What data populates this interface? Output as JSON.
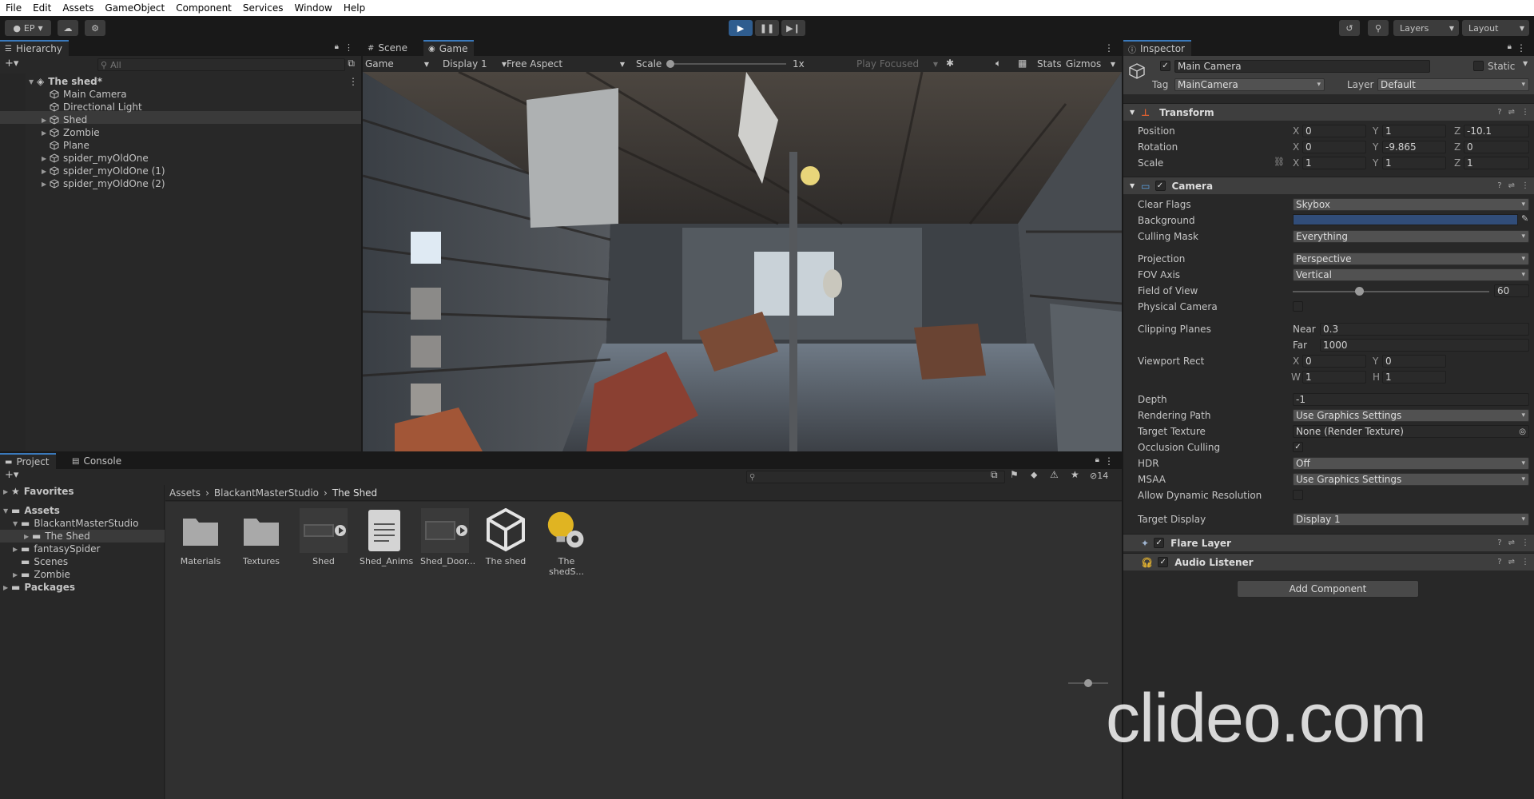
{
  "menu": [
    "File",
    "Edit",
    "Assets",
    "GameObject",
    "Component",
    "Services",
    "Window",
    "Help"
  ],
  "toolbar": {
    "account": "EP",
    "layers": "Layers",
    "layout": "Layout"
  },
  "hierarchy": {
    "tab": "Hierarchy",
    "search_placeholder": "All",
    "scene": "The shed*",
    "items": [
      "Main Camera",
      "Directional Light",
      "Shed",
      "Zombie",
      "Plane",
      "spider_myOldOne",
      "spider_myOldOne (1)",
      "spider_myOldOne (2)"
    ]
  },
  "game": {
    "tabs": [
      "Scene",
      "Game"
    ],
    "mode": "Game",
    "display": "Display 1",
    "aspect": "Free Aspect",
    "scale_label": "Scale",
    "scale_value": "1x",
    "play_focused": "Play Focused",
    "stats": "Stats",
    "gizmos": "Gizmos"
  },
  "project": {
    "tabs": [
      "Project",
      "Console"
    ],
    "hidden_count": "14",
    "breadcrumb": [
      "Assets",
      "BlackantMasterStudio",
      "The Shed"
    ],
    "tree": {
      "favorites": "Favorites",
      "assets": "Assets",
      "items": [
        "BlackantMasterStudio",
        "The Shed",
        "fantasySpider",
        "Scenes",
        "Zombie"
      ],
      "packages": "Packages"
    },
    "assets": [
      "Materials",
      "Textures",
      "Shed",
      "Shed_Anims",
      "Shed_Door...",
      "The shed",
      "The shedS..."
    ]
  },
  "inspector": {
    "tab": "Inspector",
    "object_name": "Main Camera",
    "static": "Static",
    "tag_label": "Tag",
    "tag": "MainCamera",
    "layer_label": "Layer",
    "layer": "Default",
    "transform": {
      "title": "Transform",
      "position_label": "Position",
      "rotation_label": "Rotation",
      "scale_label": "Scale",
      "position": [
        "0",
        "1",
        "-10.1"
      ],
      "rotation": [
        "0",
        "-9.865",
        "0"
      ],
      "scale": [
        "1",
        "1",
        "1"
      ]
    },
    "camera": {
      "title": "Camera",
      "clear_flags_label": "Clear Flags",
      "clear_flags": "Skybox",
      "background_label": "Background",
      "culling_mask_label": "Culling Mask",
      "culling_mask": "Everything",
      "projection_label": "Projection",
      "projection": "Perspective",
      "fov_axis_label": "FOV Axis",
      "fov_axis": "Vertical",
      "fov_label": "Field of View",
      "fov": "60",
      "physical_label": "Physical Camera",
      "clipping_label": "Clipping Planes",
      "near_label": "Near",
      "near": "0.3",
      "far_label": "Far",
      "far": "1000",
      "viewport_label": "Viewport Rect",
      "viewport": {
        "x": "0",
        "y": "0",
        "w": "1",
        "h": "1"
      },
      "depth_label": "Depth",
      "depth": "-1",
      "rendering_path_label": "Rendering Path",
      "rendering_path": "Use Graphics Settings",
      "target_texture_label": "Target Texture",
      "target_texture": "None (Render Texture)",
      "occlusion_label": "Occlusion Culling",
      "hdr_label": "HDR",
      "hdr": "Off",
      "msaa_label": "MSAA",
      "msaa": "Use Graphics Settings",
      "dynres_label": "Allow Dynamic Resolution",
      "target_display_label": "Target Display",
      "target_display": "Display 1"
    },
    "flare_layer": "Flare Layer",
    "audio_listener": "Audio Listener",
    "add_component": "Add Component"
  },
  "watermark": "clideo.com",
  "colors": {
    "accent": "#3a79bb",
    "camera_bg": "#314d79",
    "play_active": "#2f5d8f"
  }
}
